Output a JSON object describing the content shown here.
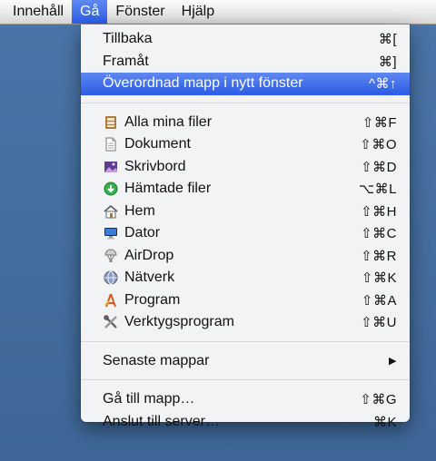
{
  "menubar": {
    "items": [
      "Innehåll",
      "Gå",
      "Fönster",
      "Hjälp"
    ],
    "active_index": 1
  },
  "menu": {
    "group1": [
      {
        "label": "Tillbaka",
        "shortcut": "⌘["
      },
      {
        "label": "Framåt",
        "shortcut": "⌘]"
      },
      {
        "label": "Överordnad mapp i nytt fönster",
        "shortcut": "^⌘↑",
        "highlighted": true
      }
    ],
    "group2": [
      {
        "label": "Alla mina filer",
        "shortcut": "⇧⌘F",
        "icon": "all-my-files-icon"
      },
      {
        "label": "Dokument",
        "shortcut": "⇧⌘O",
        "icon": "document-icon"
      },
      {
        "label": "Skrivbord",
        "shortcut": "⇧⌘D",
        "icon": "desktop-icon"
      },
      {
        "label": "Hämtade filer",
        "shortcut": "⌥⌘L",
        "icon": "download-icon"
      },
      {
        "label": "Hem",
        "shortcut": "⇧⌘H",
        "icon": "home-icon"
      },
      {
        "label": "Dator",
        "shortcut": "⇧⌘C",
        "icon": "computer-icon"
      },
      {
        "label": "AirDrop",
        "shortcut": "⇧⌘R",
        "icon": "airdrop-icon"
      },
      {
        "label": "Nätverk",
        "shortcut": "⇧⌘K",
        "icon": "network-icon"
      },
      {
        "label": "Program",
        "shortcut": "⇧⌘A",
        "icon": "applications-icon"
      },
      {
        "label": "Verktygsprogram",
        "shortcut": "⇧⌘U",
        "icon": "utilities-icon"
      }
    ],
    "group3": [
      {
        "label": "Senaste mappar",
        "submenu_arrow": "▶"
      }
    ],
    "group4": [
      {
        "label": "Gå till mapp…",
        "shortcut": "⇧⌘G"
      },
      {
        "label": "Anslut till server…",
        "shortcut": "⌘K"
      }
    ]
  },
  "colors": {
    "highlight": "#2b5ae5",
    "desktop": "#3f6a9b"
  }
}
